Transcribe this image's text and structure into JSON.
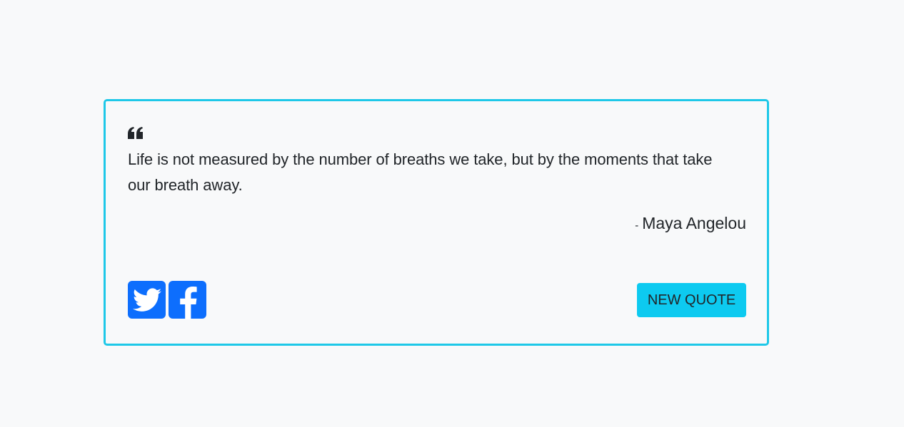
{
  "quote": {
    "text": "Life is not measured by the number of breaths we take, but by the moments that take our breath away.",
    "author_dash": "-",
    "author": "Maya Angelou"
  },
  "share": {
    "twitter_icon": "twitter-icon",
    "facebook_icon": "facebook-icon"
  },
  "new_quote_label": "NEW QUOTE",
  "colors": {
    "border": "#1ec8e8",
    "social_bg": "#0d6efd",
    "button_bg": "#0dcaf0",
    "text": "#212529",
    "page_bg": "#f8f9fa"
  }
}
